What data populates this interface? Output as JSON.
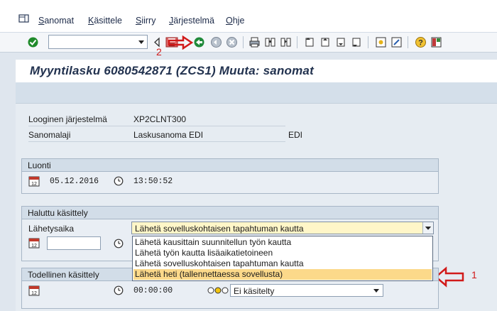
{
  "menu": {
    "items": [
      {
        "first": "S",
        "rest": "anomat"
      },
      {
        "first": "K",
        "rest": "äsittele"
      },
      {
        "first": "S",
        "rest": "iirry"
      },
      {
        "first": "J",
        "rest": "ärjestelmä"
      },
      {
        "first": "O",
        "rest": "hje"
      }
    ]
  },
  "toolbar": {
    "command_value": ""
  },
  "title": "Myyntilasku 6080542871 (ZCS1) Muuta: sanomat",
  "header": {
    "logical_system_label": "Looginen järjestelmä",
    "logical_system_value": "XP2CLNT300",
    "message_type_label": "Sanomalaji",
    "message_type_value": "Laskusanoma EDI",
    "message_type_code": "EDI"
  },
  "creation": {
    "group_title": "Luonti",
    "date": "05.12.2016",
    "time": "13:50:52"
  },
  "requested": {
    "group_title": "Haluttu käsittely",
    "send_time_label": "Lähetysaika",
    "selected_option": "Lähetä sovelluskohtaisen tapahtuman kautta",
    "options": [
      "Lähetä kausittain suunnitellun työn kautta",
      "Lähetä työn kautta lisäaikatietoineen",
      "Lähetä sovelluskohtaisen tapahtuman kautta",
      "Lähetä heti (tallennettaessa sovellusta)"
    ]
  },
  "actual": {
    "group_title": "Todellinen käsittely",
    "time": "00:00:00",
    "status": "Ei käsitelty"
  },
  "annotations": {
    "arrow1_label": "1",
    "arrow2_label": "2"
  },
  "colors": {
    "annotation_red": "#d11a1a",
    "highlight_yellow": "#fcd98a"
  }
}
